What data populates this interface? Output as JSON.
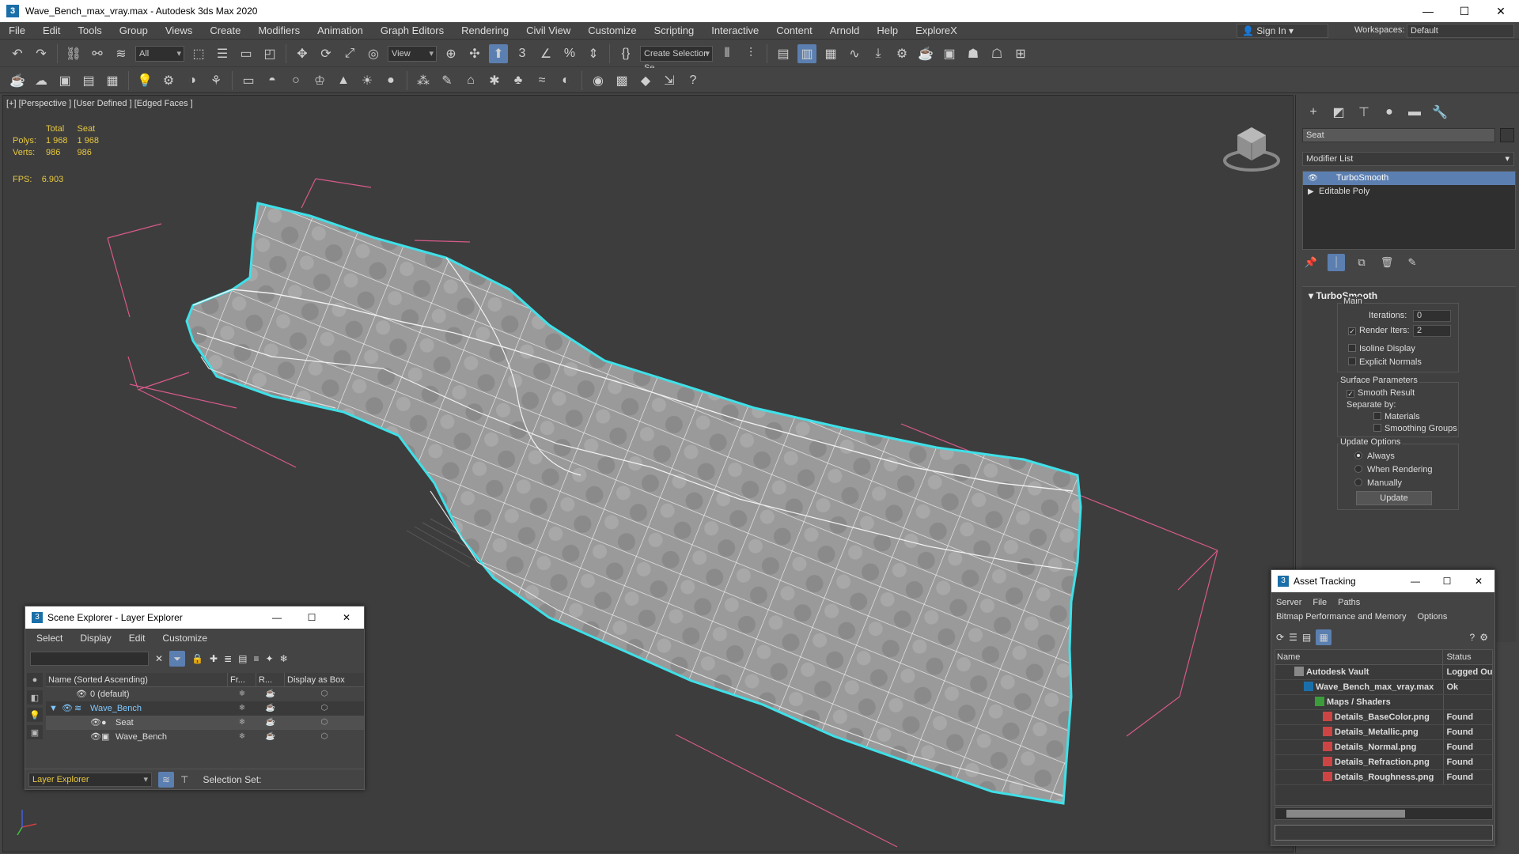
{
  "titlebar": {
    "title": "Wave_Bench_max_vray.max - Autodesk 3ds Max 2020",
    "minimize": "—",
    "maximize": "☐",
    "close": "✕"
  },
  "menubar": {
    "items": [
      "File",
      "Edit",
      "Tools",
      "Group",
      "Views",
      "Create",
      "Modifiers",
      "Animation",
      "Graph Editors",
      "Rendering",
      "Civil View",
      "Customize",
      "Scripting",
      "Interactive",
      "Content",
      "Arnold",
      "Help",
      "ExploreX"
    ]
  },
  "signin": {
    "label": "Sign In"
  },
  "workspaces": {
    "label": "Workspaces:",
    "value": "Default"
  },
  "toolbar1": {
    "selection_filter": "All",
    "ref_coord": "View",
    "named_selection": "Create Selection Se"
  },
  "viewport": {
    "label": "[+] [Perspective ] [User Defined ] [Edged Faces ]",
    "stats": {
      "header_total": "Total",
      "header_seat": "Seat",
      "polys_label": "Polys:",
      "polys_total": "1 968",
      "polys_seat": "1 968",
      "verts_label": "Verts:",
      "verts_total": "986",
      "verts_seat": "986"
    },
    "fps_label": "FPS:",
    "fps_value": "6.903"
  },
  "command_panel": {
    "object_name": "Seat",
    "modifier_list": "Modifier List",
    "stack": [
      {
        "label": "TurboSmooth",
        "selected": true
      },
      {
        "label": "Editable Poly",
        "selected": false
      }
    ],
    "rollout_title": "TurboSmooth",
    "main_group": "Main",
    "iterations_label": "Iterations:",
    "iterations_value": "0",
    "render_iters_label": "Render Iters:",
    "render_iters_value": "2",
    "isoline_label": "Isoline Display",
    "explicit_normals_label": "Explicit Normals",
    "surface_group": "Surface Parameters",
    "smooth_result_label": "Smooth Result",
    "separate_by_label": "Separate by:",
    "materials_label": "Materials",
    "smoothing_groups_label": "Smoothing Groups",
    "update_group": "Update Options",
    "always_label": "Always",
    "when_rendering_label": "When Rendering",
    "manually_label": "Manually",
    "update_button": "Update"
  },
  "scene_explorer": {
    "title": "Scene Explorer - Layer Explorer",
    "menu": [
      "Select",
      "Display",
      "Edit",
      "Customize"
    ],
    "columns": [
      "Name (Sorted Ascending)",
      "Fr...",
      "R...",
      "Display as Box"
    ],
    "rows": [
      {
        "name": "0 (default)"
      },
      {
        "name": "Wave_Bench"
      },
      {
        "name": "Seat"
      },
      {
        "name": "Wave_Bench"
      }
    ],
    "footer_dropdown": "Layer Explorer",
    "selection_set_label": "Selection Set:"
  },
  "asset_tracking": {
    "title": "Asset Tracking",
    "menu_row1": [
      "Server",
      "File",
      "Paths"
    ],
    "menu_row2": [
      "Bitmap Performance and Memory",
      "Options"
    ],
    "columns": [
      "Name",
      "Status"
    ],
    "rows": [
      {
        "name": "Autodesk Vault",
        "status": "Logged Ou"
      },
      {
        "name": "Wave_Bench_max_vray.max",
        "status": "Ok"
      },
      {
        "name": "Maps / Shaders",
        "status": ""
      },
      {
        "name": "Details_BaseColor.png",
        "status": "Found"
      },
      {
        "name": "Details_Metallic.png",
        "status": "Found"
      },
      {
        "name": "Details_Normal.png",
        "status": "Found"
      },
      {
        "name": "Details_Refraction.png",
        "status": "Found"
      },
      {
        "name": "Details_Roughness.png",
        "status": "Found"
      }
    ]
  },
  "colors": {
    "accent": "#5b7fb0",
    "stats": "#e8c840",
    "selection_outline": "#3fe0e8",
    "bbox": "#d85a8a"
  }
}
